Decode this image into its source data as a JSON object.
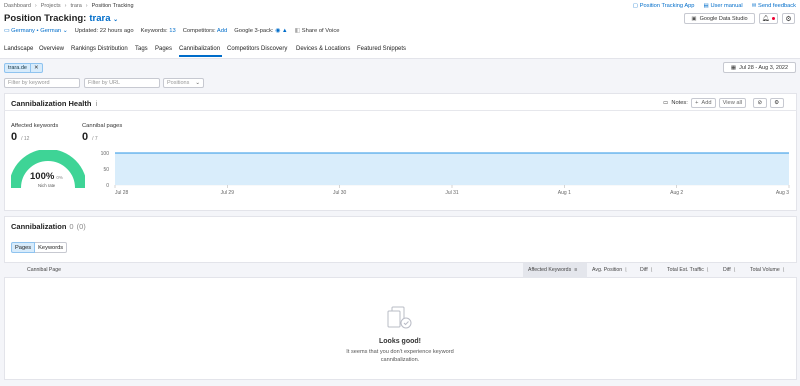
{
  "breadcrumb": [
    "Dashboard",
    "Projects",
    "trara",
    "Position Tracking"
  ],
  "top_links": {
    "app": "Position Tracking App",
    "manual": "User manual",
    "feedback": "Send feedback"
  },
  "title": {
    "prefix": "Position Tracking:",
    "project": "trara"
  },
  "buttons": {
    "gds": "Google Data Studio"
  },
  "info": {
    "location": "Germany • German",
    "updated": "Updated: 22 hours ago",
    "keywords_label": "Keywords:",
    "keywords_value": "13",
    "competitors_label": "Competitors:",
    "competitors_value": "Add",
    "pack_label": "Google 3-pack:",
    "sov_label": "Share of Voice"
  },
  "tabs": [
    "Landscape",
    "Overview",
    "Rankings Distribution",
    "Tags",
    "Pages",
    "Cannibalization",
    "Competitors Discovery",
    "Devices & Locations",
    "Featured Snippets"
  ],
  "active_tab": "Cannibalization",
  "filters": {
    "domain_chip": "trara.de",
    "keyword_placeholder": "Filter by keyword",
    "url_placeholder": "Filter by URL",
    "positions": "Positions",
    "date_range": "Jul 28 - Aug 3, 2022"
  },
  "health": {
    "title": "Cannibalization Health",
    "info_mark": "i",
    "notes": "Notes:",
    "add": "Add",
    "view_all": "View all",
    "affected_label": "Affected keywords",
    "affected_value": "0",
    "affected_total": "/ 12",
    "cannibal_label": "Cannibal pages",
    "cannibal_value": "0",
    "cannibal_total": "/ 7",
    "gauge_value": "100%",
    "gauge_delta": "0%",
    "gauge_label": "Nich rate"
  },
  "chart_data": {
    "type": "area",
    "x": [
      "Jul 28",
      "Jul 29",
      "Jul 30",
      "Jul 31",
      "Aug 1",
      "Aug 2",
      "Aug 3"
    ],
    "y_ticks": [
      100,
      50,
      0
    ],
    "values": [
      100,
      100,
      100,
      100,
      100,
      100,
      100
    ],
    "ylim": [
      0,
      100
    ],
    "color": "#2b95e6",
    "fill": "#d9edfb"
  },
  "cannibalization": {
    "title": "Cannibalization",
    "count": "0",
    "paren": "(0)",
    "toggle": [
      "Pages",
      "Keywords"
    ],
    "columns": {
      "page": "Cannibal Page",
      "affected": "Affected Keywords",
      "avg_pos": "Avg. Position",
      "diff1": "Diff",
      "traffic": "Total Est. Traffic",
      "diff2": "Diff",
      "volume": "Total Volume"
    },
    "empty_title": "Looks good!",
    "empty_text_1": "It seems that you don't experience keyword",
    "empty_text_2": "cannibalization."
  },
  "colors": {
    "accent": "#006dca",
    "gauge": "#3ed496",
    "line": "#2b95e6"
  }
}
